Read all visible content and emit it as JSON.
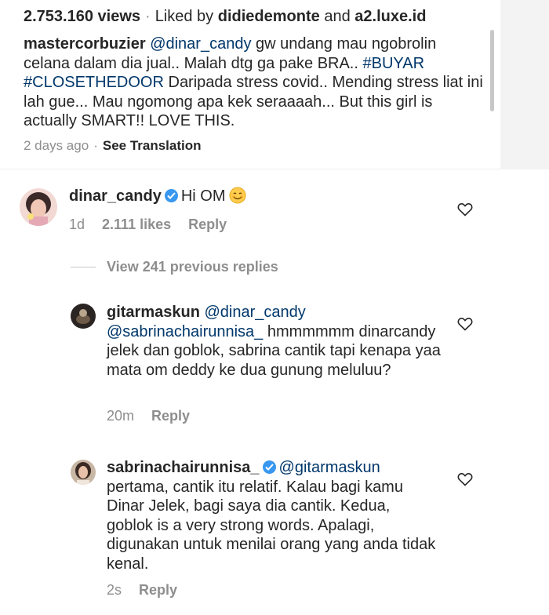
{
  "post": {
    "views": "2.753.160 views",
    "liked_by_prefix": "Liked by",
    "liked_by_user": "didiedemonte",
    "liked_by_and": "and",
    "liked_by_other": "a2.luxe.id",
    "caption_user": "mastercorbuzier",
    "caption_mention": "@dinar_candy",
    "caption_text_1": " gw undang mau ngobrolin celana dalam dia jual.. Malah dtg ga pake BRA.. ",
    "hashtag_1": "#BUYAR",
    "hashtag_2": "#CLOSETHEDOOR",
    "caption_text_2": " Daripada stress covid.. Mending stress liat ini lah gue... Mau ngomong apa kek seraaaah... But this girl is actually SMART!! LOVE THIS.",
    "time": "2 days ago",
    "see_translation": "See Translation"
  },
  "comment_main": {
    "user": "dinar_candy",
    "text": "Hi OM",
    "time": "1d",
    "likes": "2.111 likes",
    "reply": "Reply"
  },
  "view_replies": "View 241 previous replies",
  "reply_1": {
    "user": "gitarmaskun",
    "mention_1": "@dinar_candy",
    "mention_2": "@sabrinachairunnisa_",
    "text": " hmmmmmm dinarcandy jelek dan goblok, sabrina cantik tapi kenapa yaa mata om deddy ke dua gunung meluluu?",
    "time": "20m",
    "reply": "Reply"
  },
  "reply_2": {
    "user": "sabrinachairunnisa_",
    "mention": "@gitarmaskun",
    "text": " pertama, cantik itu relatif. Kalau bagi kamu Dinar Jelek, bagi saya dia cantik. Kedua, goblok is a very strong words. Apalagi, digunakan untuk menilai orang yang anda tidak kenal.",
    "time": "2s",
    "reply": "Reply"
  },
  "icons": {
    "heart": "heart-icon",
    "verified": "verified-badge-icon",
    "emoji": "smiling-face-emoji-icon"
  },
  "colors": {
    "link": "#00376b",
    "muted": "#8e8e8e",
    "text": "#262626",
    "verified": "#3897f0"
  }
}
